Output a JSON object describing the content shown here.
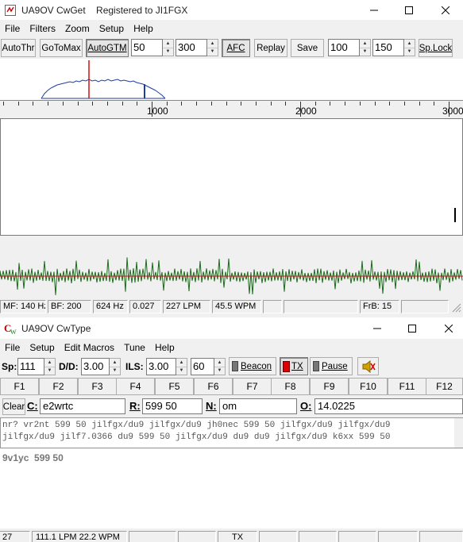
{
  "cwget": {
    "title": "UA9OV CwGet    Registered to JI1FGX",
    "menu": [
      "File",
      "Filters",
      "Zoom",
      "Setup",
      "Help"
    ],
    "toolbar": {
      "autothr": "AutoThr",
      "gotomax": "GoToMax",
      "autogtm": "AutoGTM",
      "spin1": "50",
      "spin2": "300",
      "afc": "AFC",
      "replay": "Replay",
      "save": "Save",
      "spin3": "100",
      "spin4": "150",
      "splock": "Sp.Lock"
    },
    "scale_labels": [
      "1000",
      "2000",
      "3000"
    ],
    "status": {
      "mf": "MF: 140 Hz",
      "bf": "BF: 200",
      "freq": "624 Hz",
      "level": "0.027",
      "lpm": "227 LPM",
      "wpm": "45.5 WPM",
      "frb": "FrB: 15"
    }
  },
  "cwtype": {
    "title": "UA9OV CwType",
    "menu": [
      "File",
      "Setup",
      "Edit Macros",
      "Tune",
      "Help"
    ],
    "controls": {
      "sp_label": "Sp:",
      "sp_value": "111",
      "dd_label": "D/D:",
      "dd_value": "3.00",
      "ils_label": "ILS:",
      "ils_value": "3.00",
      "extra_value": "60",
      "beacon": "Beacon",
      "tx": "TX",
      "pause": "Pause"
    },
    "fkeys": [
      "F1",
      "F2",
      "F3",
      "F4",
      "F5",
      "F6",
      "F7",
      "F8",
      "F9",
      "F10",
      "F11",
      "F12"
    ],
    "fields": {
      "clear": "Clear",
      "c_label": "C:",
      "c_value": "e2wrtc",
      "r_label": "R:",
      "r_value": "599 50",
      "n_label": "N:",
      "n_value": "om",
      "o_label": "O:",
      "o_value": "14.0225"
    },
    "received": {
      "line1": "nr? vr2nt 599 50 jilfgx/du9 jilfgx/du9 jh0nec 599 50 jilfgx/du9 jilfgx/du9",
      "line2": "jilfgx/du9 jilf7.0366 du9 599 50 jilfgx/du9 du9 du9 jilfgx/du9 k6xx 599 50"
    },
    "typed": "9v1yc  599 50",
    "status": {
      "s1": "27",
      "s2": "111.1 LPM  22.2 WPM",
      "s3": "TX"
    }
  },
  "colors": {
    "spectrum": "#1f3f9a",
    "marker": "#d01010",
    "oscillo": "#1a6a1a",
    "tx_indicator": "#e00000"
  }
}
